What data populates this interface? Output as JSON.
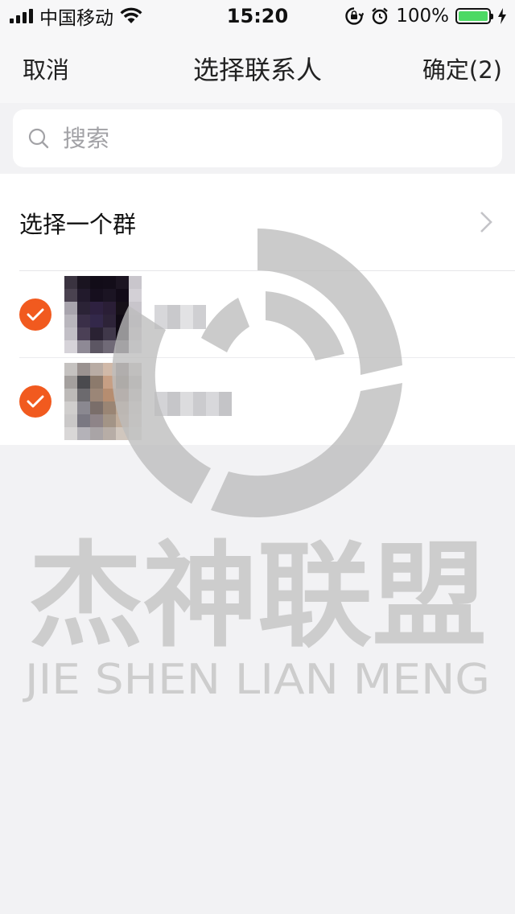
{
  "status_bar": {
    "carrier": "中国移动",
    "time": "15:20",
    "battery_percent": "100%",
    "battery_level": 1.0
  },
  "nav": {
    "cancel_label": "取消",
    "title": "选择联系人",
    "confirm_label": "确定(2)"
  },
  "search": {
    "placeholder": "搜索"
  },
  "group_select": {
    "label": "选择一个群"
  },
  "contacts": [
    {
      "selected": true
    },
    {
      "selected": true
    }
  ],
  "watermark": {
    "title": "杰神联盟",
    "subtitle": "JIE SHEN LIAN MENG"
  },
  "colors": {
    "accent": "#f15a1f",
    "battery": "#4cd964",
    "background": "#f2f2f4"
  }
}
